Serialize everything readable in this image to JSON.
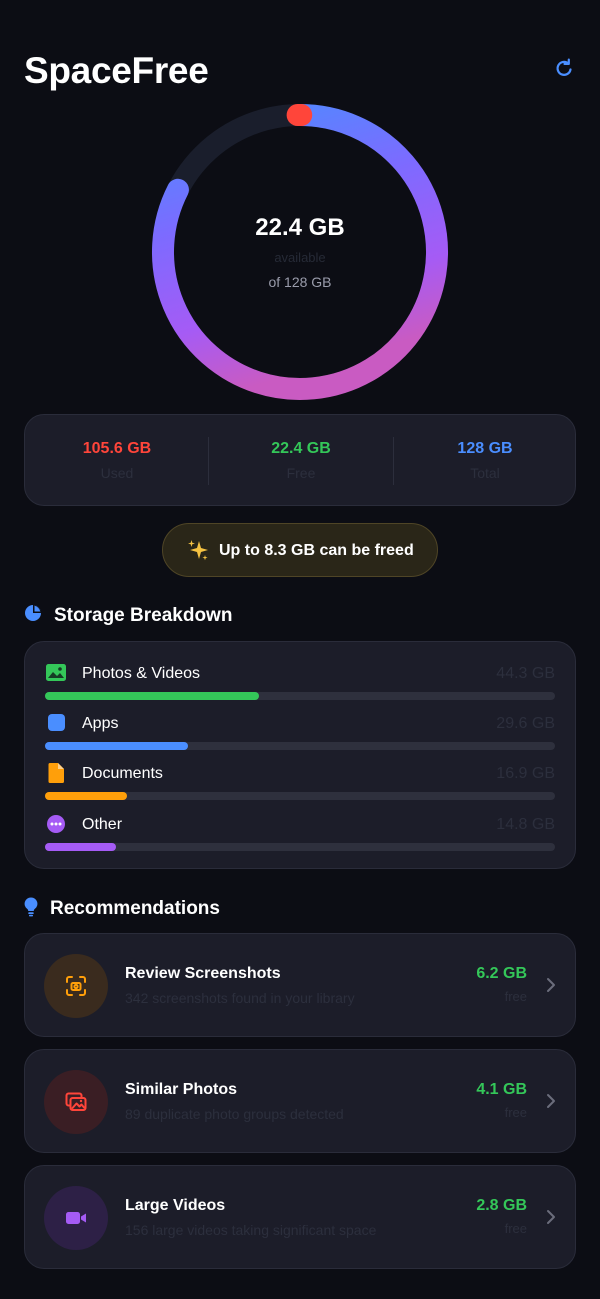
{
  "app": {
    "title": "SpaceFree",
    "refresh_icon": "refresh-icon"
  },
  "gauge": {
    "value_label": "22.4 GB",
    "sub_label": "available",
    "of_label": "of 128 GB",
    "used_fraction": 0.825,
    "track_color": "#1a1e2c",
    "gradient_colors": [
      "#4a8eff",
      "#7c6bff",
      "#a55bf5",
      "#c95bc2"
    ],
    "cap_color": "#ff453a"
  },
  "stats": [
    {
      "value": "105.6 GB",
      "label": "Used",
      "color": "#ff453a"
    },
    {
      "value": "22.4 GB",
      "label": "Free",
      "color": "#34c759"
    },
    {
      "value": "128 GB",
      "label": "Total",
      "color": "#4a8eff"
    }
  ],
  "freed_banner": {
    "icon": "sparkles-icon",
    "text": "Up to 8.3 GB can be freed"
  },
  "breakdown": {
    "title": "Storage Breakdown",
    "icon": "pie-chart-icon",
    "items": [
      {
        "label": "Photos & Videos",
        "size": "44.3 GB",
        "fraction": 0.419,
        "color": "#34c759",
        "icon": "photo-icon"
      },
      {
        "label": "Apps",
        "size": "29.6 GB",
        "fraction": 0.28,
        "color": "#4a8eff",
        "icon": "app-icon"
      },
      {
        "label": "Documents",
        "size": "16.9 GB",
        "fraction": 0.16,
        "color": "#ff9f0a",
        "icon": "document-icon"
      },
      {
        "label": "Other",
        "size": "14.8 GB",
        "fraction": 0.14,
        "color": "#a55bf5",
        "icon": "more-icon"
      }
    ]
  },
  "recommendations": {
    "title": "Recommendations",
    "icon": "lightbulb-icon",
    "items": [
      {
        "title": "Review Screenshots",
        "desc": "342 screenshots found in your library",
        "size": "6.2 GB",
        "free_label": "free",
        "icon": "screenshot-icon",
        "color": "#ff9f0a"
      },
      {
        "title": "Similar Photos",
        "desc": "89 duplicate photo groups detected",
        "size": "4.1 GB",
        "free_label": "free",
        "icon": "photos-stack-icon",
        "color": "#ff453a"
      },
      {
        "title": "Large Videos",
        "desc": "156 large videos taking significant space",
        "size": "2.8 GB",
        "free_label": "free",
        "icon": "video-icon",
        "color": "#a55bf5"
      }
    ]
  }
}
